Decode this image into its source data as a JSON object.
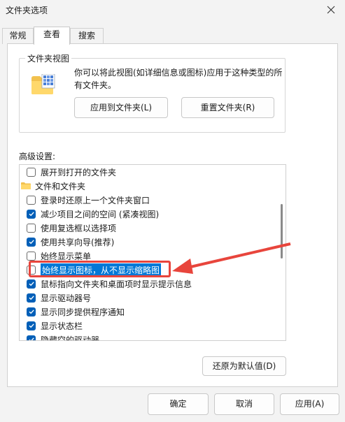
{
  "window": {
    "title": "文件夹选项"
  },
  "tabs": [
    {
      "label": "常规"
    },
    {
      "label": "查看"
    },
    {
      "label": "搜索"
    }
  ],
  "folder_view": {
    "group_title": "文件夹视图",
    "description": "你可以将此视图(如详细信息或图标)应用于这种类型的所有文件夹。",
    "apply_button": "应用到文件夹(L)",
    "reset_button": "重置文件夹(R)"
  },
  "advanced": {
    "label": "高级设置:",
    "items": [
      {
        "label": "展开到打开的文件夹",
        "checked": false,
        "highlighted": false
      },
      {
        "label": "文件和文件夹",
        "category": true
      },
      {
        "label": "登录时还原上一个文件夹窗口",
        "checked": false,
        "highlighted": false
      },
      {
        "label": "减少项目之间的空间 (紧凑视图)",
        "checked": true,
        "highlighted": false
      },
      {
        "label": "使用复选框以选择项",
        "checked": false,
        "highlighted": false
      },
      {
        "label": "使用共享向导(推荐)",
        "checked": true,
        "highlighted": false
      },
      {
        "label": "始终显示菜单",
        "checked": false,
        "highlighted": false
      },
      {
        "label": "始终显示图标，从不显示缩略图",
        "checked": false,
        "highlighted": true
      },
      {
        "label": "鼠标指向文件夹和桌面项时显示提示信息",
        "checked": true,
        "highlighted": false
      },
      {
        "label": "显示驱动器号",
        "checked": true,
        "highlighted": false
      },
      {
        "label": "显示同步提供程序通知",
        "checked": true,
        "highlighted": false
      },
      {
        "label": "显示状态栏",
        "checked": true,
        "highlighted": false
      },
      {
        "label": "隐藏空的驱动器",
        "checked": true,
        "highlighted": false
      }
    ],
    "restore_button": "还原为默认值(D)"
  },
  "footer": {
    "ok": "确定",
    "cancel": "取消",
    "apply": "应用(A)"
  },
  "colors": {
    "accent": "#005fb8",
    "highlight": "#0078d7",
    "annotation": "#e8453c"
  }
}
